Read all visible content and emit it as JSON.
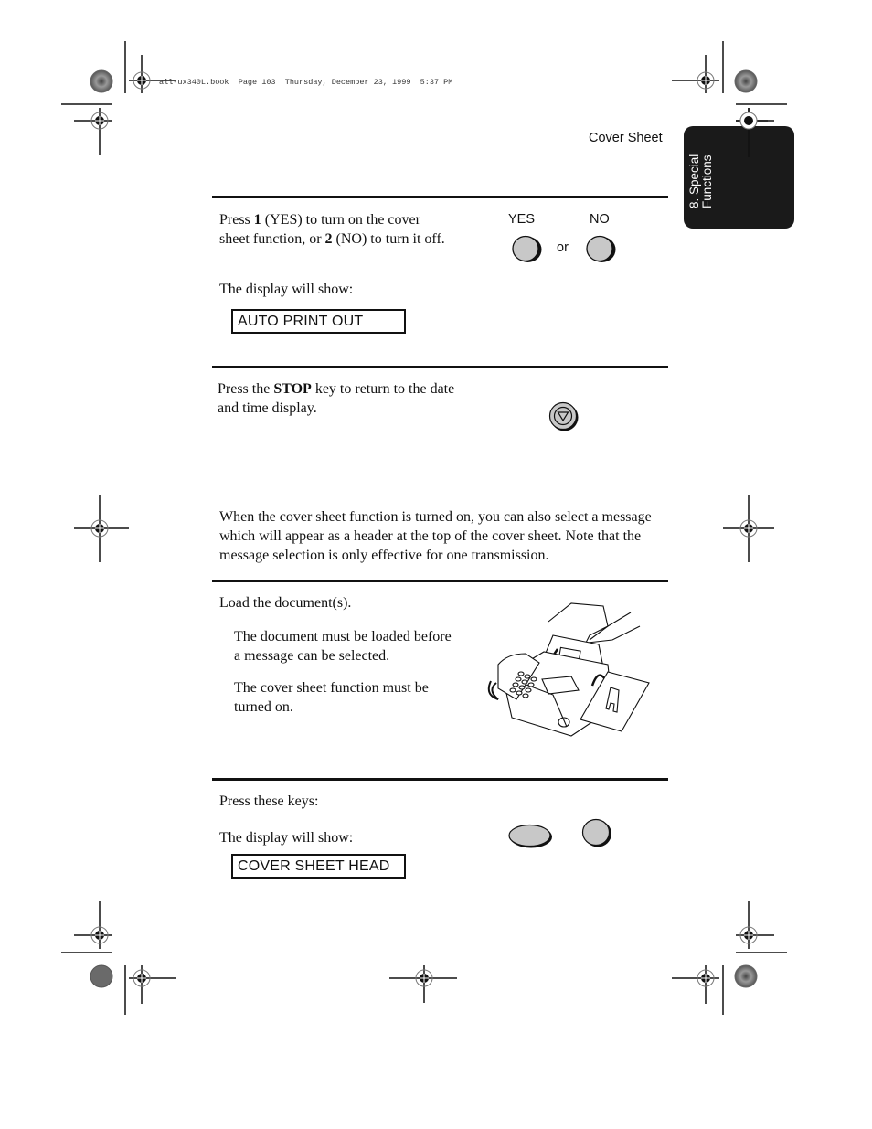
{
  "print_header": "all-ux340L.book  Page 103  Thursday, December 23, 1999  5:37 PM",
  "running_head": "Cover Sheet",
  "section_tab": {
    "line1": "8. Special",
    "line2": "Functions"
  },
  "steps": [
    {
      "text_parts": [
        "Press ",
        "1",
        " (YES) to turn on the cover sheet function, or ",
        "2",
        " (NO) to turn it off."
      ],
      "display_intro": "The display will show:",
      "display_value": "AUTO PRINT OUT",
      "keys": {
        "yes_label": "YES",
        "no_label": "NO",
        "or_label": "or"
      }
    },
    {
      "text_parts": [
        "Press the ",
        "STOP",
        " key to return to the date and time display."
      ],
      "key_icon": "stop-key"
    }
  ],
  "intro_paragraph": "When the cover sheet function is turned on, you can also select a message which will appear as a header at the top of the cover sheet. Note that the message selection is only effective for one transmission.",
  "steps2": [
    {
      "text": "Load the document(s).",
      "notes": [
        "The document must be loaded before a message can be selected.",
        "The cover sheet function must be turned on."
      ],
      "illustration": "fax-machine-loading-document"
    },
    {
      "text": "Press these keys:",
      "display_intro": "The display will show:",
      "display_value": "COVER SHEET HEAD",
      "keys": [
        "function-key",
        "number-key"
      ]
    }
  ]
}
